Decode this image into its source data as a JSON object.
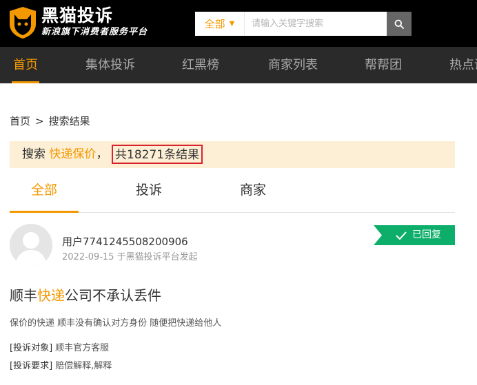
{
  "brand": {
    "title": "黑猫投诉",
    "subtitle": "新浪旗下消费者服务平台"
  },
  "search": {
    "scope": "全部",
    "placeholder": "请输入关键字搜索"
  },
  "nav": {
    "items": [
      "首页",
      "集体投诉",
      "红黑榜",
      "商家列表",
      "帮帮团",
      "热点话题"
    ],
    "active_index": 0
  },
  "breadcrumb": {
    "home": "首页",
    "separator": ">",
    "current": "搜索结果"
  },
  "result": {
    "prefix": "搜索",
    "keyword": "快递保价",
    "punct": "，",
    "count_text": "共18271条结果"
  },
  "tabs": {
    "items": [
      "全部",
      "投诉",
      "商家"
    ],
    "active_index": 0
  },
  "complaint": {
    "user": "用户7741245508200906",
    "meta": "2022-09-15 于黑猫投诉平台发起",
    "status": "已回复",
    "title_before": "顺丰",
    "title_highlight": "快递",
    "title_after": "公司不承认丢件",
    "summary": "保价的快递 顺丰没有确认对方身份 随便把快递给他人",
    "target_label": "[投诉对象]",
    "target_value": "顺丰官方客服",
    "request_label": "[投诉要求]",
    "request_value": "赔偿解释,解释"
  },
  "colors": {
    "accent": "#f39800",
    "header_bg": "#000000",
    "nav_bg": "#2a2a2a",
    "badge_green": "#0dae6a",
    "highlight_border": "#d9232a",
    "result_bg": "#fdefd5"
  },
  "icons": {
    "logo": "cat-shield-icon",
    "caret": "chevron-down-icon",
    "search": "search-icon",
    "check": "check-icon",
    "avatar": "user-avatar-icon"
  }
}
